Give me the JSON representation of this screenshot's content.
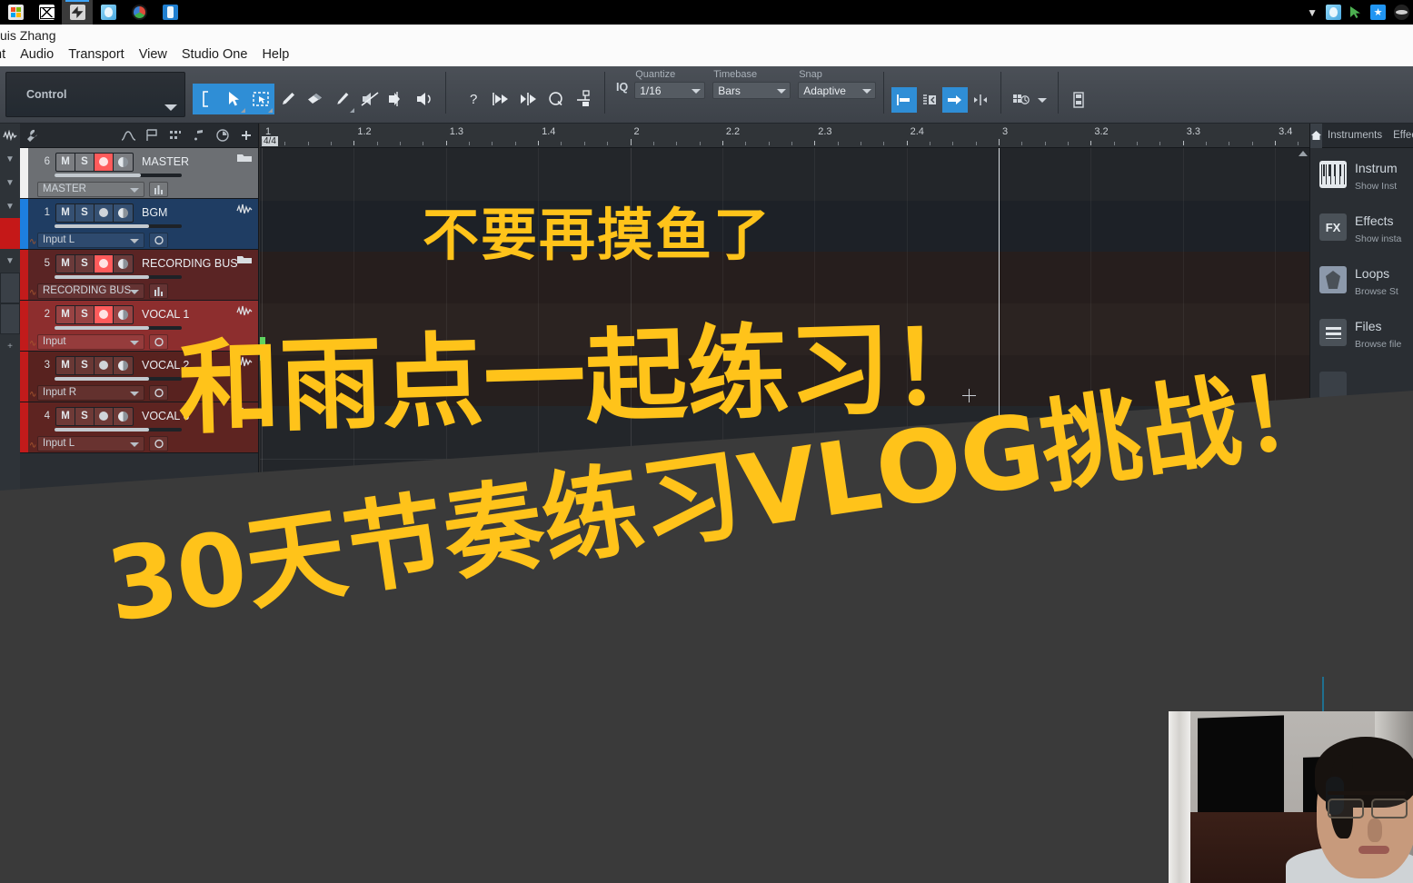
{
  "taskbar": {
    "left_icons": [
      "microsoft-store-icon",
      "mail-icon",
      "studio-one-icon",
      "photo-app-icon",
      "color-wheel-icon",
      "phone-link-icon"
    ],
    "right_icons": [
      "chevron-up-icon",
      "photo-app-icon",
      "green-cursor-icon",
      "star-app-icon",
      "hidden-icons-icon"
    ]
  },
  "window": {
    "title": "uis Zhang",
    "menu": [
      "nt",
      "Audio",
      "Transport",
      "View",
      "Studio One",
      "Help"
    ]
  },
  "toolbar": {
    "control_label": "Control",
    "tools": [
      {
        "name": "range-tool",
        "selected": true
      },
      {
        "name": "arrow-tool",
        "selected": true
      },
      {
        "name": "marquee-tool",
        "selected": true
      },
      {
        "name": "paint-tool",
        "selected": false
      },
      {
        "name": "eraser-tool",
        "selected": false
      },
      {
        "name": "split-tool",
        "selected": false
      },
      {
        "name": "mute-tool",
        "selected": false
      },
      {
        "name": "bend-tool",
        "selected": false
      },
      {
        "name": "listen-tool",
        "selected": false
      }
    ],
    "help_icons": [
      "question-icon",
      "play-to-end-icon",
      "play-from-cursor-icon",
      "q-quantize-icon",
      "bounce-icon"
    ],
    "iq_label": "IQ",
    "quantize": {
      "label": "Quantize",
      "value": "1/16"
    },
    "timebase": {
      "label": "Timebase",
      "value": "Bars"
    },
    "snap": {
      "label": "Snap",
      "value": "Adaptive"
    },
    "right_buttons": [
      {
        "name": "snap-to-bar-button",
        "active": true
      },
      {
        "name": "snap-grid-button",
        "active": false
      },
      {
        "name": "snap-end-button",
        "active": true
      },
      {
        "name": "snap-relative-button",
        "active": false
      },
      {
        "name": "grid-view-button",
        "active": false
      },
      {
        "name": "arranger-track-button",
        "active": false
      }
    ]
  },
  "track_toolbar": {
    "icons": [
      "wrench-icon",
      "automation-icon",
      "marker-icon",
      "grid-icon",
      "notes-icon",
      "tempo-icon",
      "add-track-icon"
    ]
  },
  "tracks": [
    {
      "num": "6",
      "name": "MASTER",
      "color_class": "t-master",
      "mute": "M",
      "solo": "S",
      "record_armed": true,
      "monitor": true,
      "volume_pct": 68,
      "io": "MASTER",
      "io_button": "channel-editor-icon",
      "end_icon": "folder-icon"
    },
    {
      "num": "1",
      "name": "BGM",
      "color_class": "t-bgm",
      "mute": "M",
      "solo": "S",
      "record_armed": false,
      "monitor": true,
      "volume_pct": 74,
      "io": "Input L",
      "io_button": "record-circle-icon",
      "end_icon": "waveform-icon"
    },
    {
      "num": "5",
      "name": "RECORDING BUS",
      "color_class": "t-recbus",
      "mute": "M",
      "solo": "S",
      "record_armed": true,
      "monitor": true,
      "volume_pct": 74,
      "io": "RECORDING BUS",
      "io_button": "channel-editor-icon",
      "end_icon": "folder-icon"
    },
    {
      "num": "2",
      "name": "VOCAL 1",
      "color_class": "t-v1",
      "mute": "M",
      "solo": "S",
      "record_armed": true,
      "monitor": true,
      "volume_pct": 74,
      "io": "Input",
      "io_button": "record-circle-icon",
      "end_icon": "waveform-icon"
    },
    {
      "num": "3",
      "name": "VOCAL 2",
      "color_class": "t-v2",
      "mute": "M",
      "solo": "S",
      "record_armed": false,
      "monitor": true,
      "volume_pct": 74,
      "io": "Input R",
      "io_button": "record-circle-icon",
      "end_icon": "waveform-icon"
    },
    {
      "num": "4",
      "name": "VOCAL 6",
      "color_class": "t-v6",
      "mute": "M",
      "solo": "S",
      "record_armed": false,
      "monitor": true,
      "volume_pct": 74,
      "io": "Input L",
      "io_button": "record-circle-icon",
      "end_icon": "waveform-icon"
    }
  ],
  "ruler": {
    "time_signature": "4/4",
    "labels": [
      "1",
      "1.2",
      "1.3",
      "1.4",
      "2",
      "2.2",
      "2.3",
      "2.4",
      "3",
      "3.2",
      "3.3",
      "3.4"
    ],
    "bar_labels": [
      "1",
      "2",
      "3"
    ]
  },
  "browser": {
    "home_icon": "home-icon",
    "tabs": [
      "Instruments",
      "Effec"
    ],
    "items": [
      {
        "icon": "piano-icon",
        "title": "Instrum",
        "subtitle": "Show Inst"
      },
      {
        "icon": "fx-icon",
        "title": "Effects",
        "subtitle": "Show insta"
      },
      {
        "icon": "loops-icon",
        "title": "Loops",
        "subtitle": "Browse St"
      },
      {
        "icon": "files-icon",
        "title": "Files",
        "subtitle": "Browse file"
      }
    ]
  },
  "overlay": {
    "line1": "不要再摸鱼了",
    "line2": "和雨点一起练习！",
    "line3": "30天节奏练习VLOG挑战！",
    "accent_color": "#FFC31A"
  },
  "webcam": {
    "name": "webcam-pip"
  },
  "colors": {
    "accent_blue": "#2f8ed6",
    "record_red": "#ff5b5b",
    "overlay_yellow": "#FFC31A",
    "window_bg": "#2f2f2f",
    "track_panel_bg": "#2a2e33"
  }
}
